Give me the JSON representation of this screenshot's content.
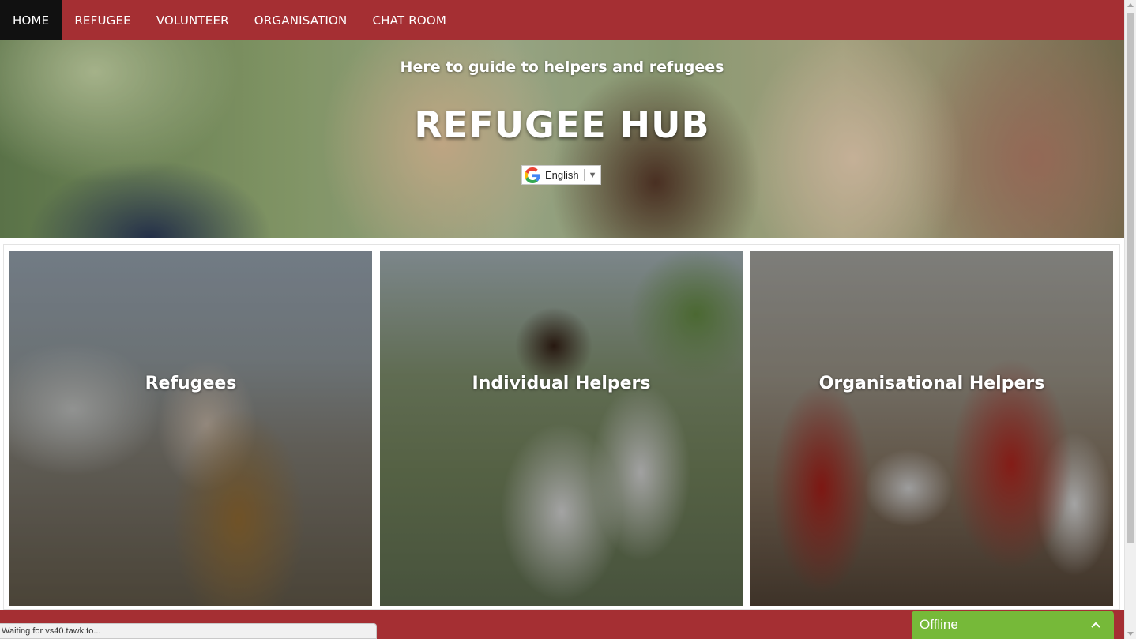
{
  "nav": {
    "items": [
      {
        "label": "HOME",
        "active": true
      },
      {
        "label": "REFUGEE",
        "active": false
      },
      {
        "label": "VOLUNTEER",
        "active": false
      },
      {
        "label": "ORGANISATION",
        "active": false
      },
      {
        "label": "CHAT ROOM",
        "active": false
      }
    ]
  },
  "hero": {
    "subtitle": "Here to guide to helpers and refugees",
    "title": "REFUGEE HUB",
    "language_selector": {
      "selected": "English",
      "icon": "google-g-icon",
      "arrow": "▼"
    }
  },
  "cards": [
    {
      "label": "Refugees"
    },
    {
      "label": "Individual Helpers"
    },
    {
      "label": "Organisational Helpers"
    }
  ],
  "status_bar": {
    "text": "Waiting for vs40.tawk.to..."
  },
  "chat_widget": {
    "label": "Offline",
    "icon": "chevron-up-icon"
  },
  "colors": {
    "brand": "#a52f33",
    "nav_active": "#111111",
    "chat_green": "#76b939"
  }
}
